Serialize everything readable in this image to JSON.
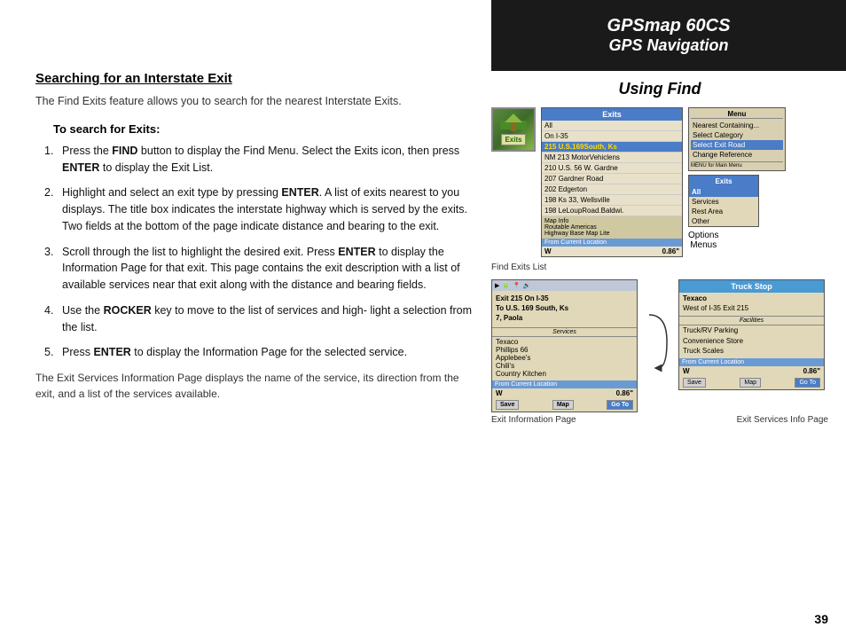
{
  "header": {
    "title": "GPSmap 60CS",
    "subtitle": "GPS Navigation"
  },
  "page": {
    "number": "39"
  },
  "content": {
    "section_title": "Searching for an Interstate Exit",
    "intro": "The Find Exits feature allows you to search for the nearest Interstate Exits.",
    "subsection": "To search for Exits:",
    "steps": [
      {
        "num": "1.",
        "text_parts": [
          "Press the ",
          "FIND",
          " button to display the Find Menu. Select the Exits icon, then press ",
          "ENTER",
          " to display the Exit List."
        ]
      },
      {
        "num": "2.",
        "text_parts": [
          "Highlight and select an exit type by pressing ",
          "ENTER",
          ". A list of exits nearest to you displays. The title box indicates the interstate highway which is served by the exits. Two fields at the bottom of the page indicate distance and bearing to the exit."
        ]
      },
      {
        "num": "3.",
        "text_parts": [
          "Scroll through the list to highlight the desired exit. Press ",
          "ENTER",
          " to display the Information Page for that exit. This page contains the exit description with a list of available services near that exit along with the distance and bearing fields."
        ]
      },
      {
        "num": "4.",
        "text_parts": [
          "Use the ",
          "ROCKER",
          " key to move to the list of services and highlight a selection from the list."
        ]
      },
      {
        "num": "5.",
        "text_parts": [
          "Press ",
          "ENTER",
          " to display the Information Page for the selected service."
        ]
      }
    ],
    "footer": "The Exit Services Information Page displays the name of the service, its direction from the exit, and a list of the services available.",
    "right": {
      "using_find_title": "Using Find",
      "exits_list_caption": "Find Exits List",
      "options_menus_labels": [
        "Options",
        "Menus"
      ],
      "exit_info_caption": "Exit Information Page",
      "exit_services_caption": "Exit Services Info Page",
      "exits_icon_label": "Exits",
      "screen1": {
        "header": "Exits",
        "row_all": "All",
        "row_on": "On I-35",
        "row1": "215 U.S.169South, Ks",
        "row2": "NM 213 MotorVehiclens",
        "row3": "210 U.S. 56 W. Gardne",
        "row4": "207 Gardner Road",
        "row5": "202 Edgerton",
        "row6": "198 Ks 33, Wellsville",
        "row7": "198 LeLoupRoad.Baldwi.",
        "map_info": "Map Info",
        "map_row1": "Routable Americas",
        "map_row2": "Highway Base Map Lite",
        "from_loc": "From Current Location",
        "bearing": "W",
        "distance": "0.86"
      },
      "screen_options": {
        "title": "Menu",
        "items": [
          "Nearest Containing...",
          "Select Category",
          "Select Exit Road",
          "Change Reference"
        ],
        "highlight_index": 2,
        "menu_label": "MENU for Main Menu"
      },
      "screen_submenu": {
        "header": "Exits",
        "items": [
          "All",
          "Services",
          "Rest Area",
          "Other"
        ],
        "highlight_index": 0
      },
      "screen_exit_info": {
        "top_icons": "▶ 🔋 📍 🔊",
        "main_text": "Exit 215 On I-35\nTo U.S. 169 South, Ks\n7, Paola",
        "services_header": "Services",
        "services": [
          "Texaco",
          "Phillips 66",
          "Applebee's",
          "Chili's",
          "Country Kitchen"
        ],
        "from_loc": "From Current Location",
        "bearing": "W",
        "distance": "0.86",
        "buttons": [
          "Save",
          "Map",
          "Go To"
        ]
      },
      "screen_truck_stop": {
        "header": "Truck Stop",
        "name": "Texaco",
        "location": "West of I-35 Exit 215",
        "facilities_header": "Facilities",
        "facilities": [
          "Truck/RV Parking",
          "Convenience Store",
          "Truck Scales"
        ],
        "from_loc": "From Current Location",
        "bearing": "W",
        "distance": "0.86",
        "buttons": [
          "Save",
          "Map",
          "Go To"
        ]
      }
    }
  }
}
